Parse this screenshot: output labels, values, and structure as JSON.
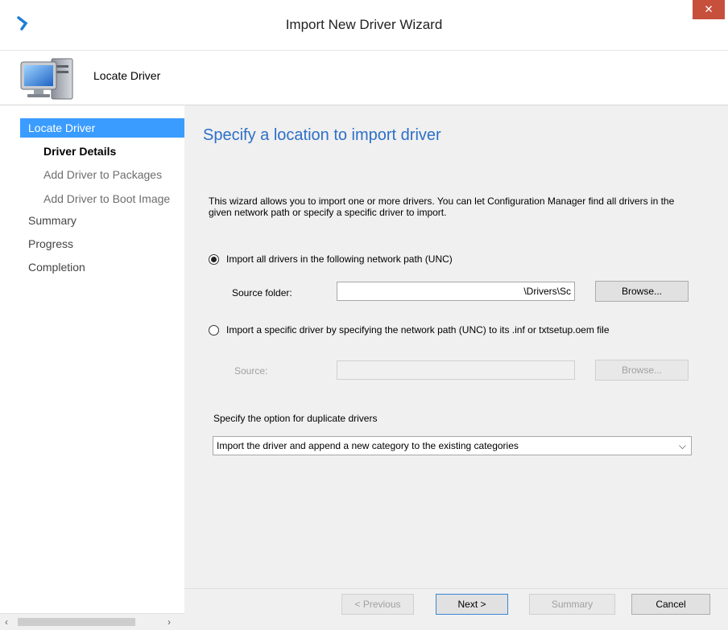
{
  "window": {
    "title": "Import New Driver Wizard",
    "close_symbol": "✕"
  },
  "header": {
    "title": "Locate Driver",
    "icon": "computer-icon"
  },
  "sidebar": {
    "items": [
      {
        "label": "Locate Driver",
        "state": "selected"
      },
      {
        "label": "Driver Details",
        "state": "bold"
      },
      {
        "label": "Add Driver to Packages",
        "state": "gray"
      },
      {
        "label": "Add Driver to Boot Image",
        "state": "gray"
      },
      {
        "label": "Summary",
        "state": "normal"
      },
      {
        "label": "Progress",
        "state": "normal"
      },
      {
        "label": "Completion",
        "state": "normal"
      }
    ],
    "scroll_left": "‹",
    "scroll_right": "›"
  },
  "main": {
    "heading": "Specify a location to import driver",
    "description": "This wizard allows you to import one or more drivers. You can let Configuration Manager find all drivers in the given network path or specify a specific driver to import.",
    "option_all": {
      "label": "Import all drivers in the following network path (UNC)",
      "checked": true,
      "source_label": "Source folder:",
      "source_value": "\\Drivers\\Sc",
      "browse_label": "Browse..."
    },
    "option_specific": {
      "label": "Import a specific driver by specifying the network path (UNC) to its .inf or txtsetup.oem file",
      "checked": false,
      "source_label": "Source:",
      "source_value": "",
      "browse_label": "Browse..."
    },
    "duplicate_label": "Specify the option for duplicate drivers",
    "duplicate_selected": "Import the driver and append a new category to the existing categories"
  },
  "footer": {
    "previous": "< Previous",
    "next": "Next >",
    "summary": "Summary",
    "cancel": "Cancel"
  },
  "colors": {
    "accent": "#3b9cff",
    "heading": "#2e6fc8",
    "close": "#c7503d"
  }
}
